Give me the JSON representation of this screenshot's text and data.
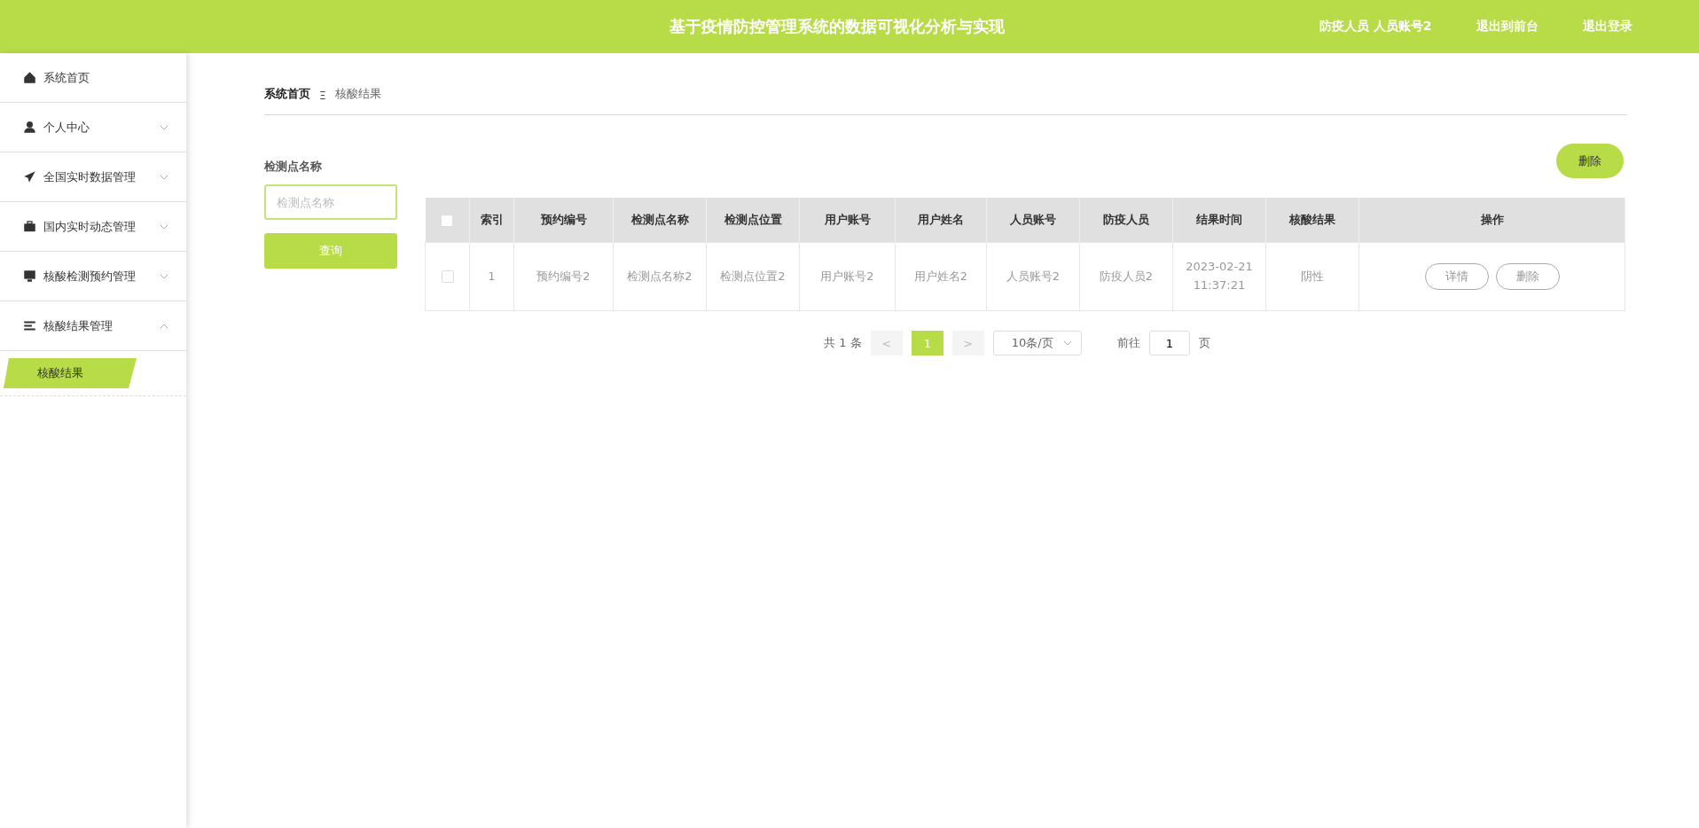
{
  "header": {
    "title": "基于疫情防控管理系统的数据可视化分析与实现",
    "user": "防疫人员 人员账号2",
    "links": [
      "退出到前台",
      "退出登录"
    ]
  },
  "sidebar": {
    "items": [
      {
        "label": "系统首页",
        "kind": "link"
      },
      {
        "label": "个人中心",
        "kind": "group",
        "expanded": false
      },
      {
        "label": "全国实时数据管理",
        "kind": "group",
        "expanded": false
      },
      {
        "label": "国内实时动态管理",
        "kind": "group",
        "expanded": false
      },
      {
        "label": "核酸检测预约管理",
        "kind": "group",
        "expanded": false
      },
      {
        "label": "核酸结果管理",
        "kind": "group",
        "expanded": true,
        "children": [
          {
            "label": "核酸结果",
            "selected": true
          }
        ]
      }
    ]
  },
  "breadcrumb": {
    "items": [
      "系统首页",
      "核酸结果"
    ],
    "separator": "Ξ"
  },
  "search": {
    "label": "检测点名称",
    "placeholder": "检测点名称",
    "button": "查询"
  },
  "delete_button": "删除",
  "table": {
    "header_checked": false,
    "columns": [
      "索引",
      "预约编号",
      "检测点名称",
      "检测点位置",
      "用户账号",
      "用户姓名",
      "人员账号",
      "防疫人员",
      "结果时间",
      "核酸结果",
      "操作"
    ],
    "rows": [
      {
        "selected": false,
        "cells": [
          "1",
          "预约编号2",
          "检测点名称2",
          "检测点位置2",
          "用户账号2",
          "用户姓名2",
          "人员账号2",
          "防疫人员2",
          "2023-02-21 11:37:21",
          "阴性"
        ],
        "actions": [
          "详情",
          "删除"
        ]
      }
    ]
  },
  "pagination": {
    "total": "共 1 条",
    "prev": "<",
    "pages": [
      {
        "label": "1",
        "selected": true
      }
    ],
    "next": ">",
    "page_size": "10条/页",
    "goto_label": "前往",
    "goto_value": "1",
    "goto_unit": "页"
  }
}
